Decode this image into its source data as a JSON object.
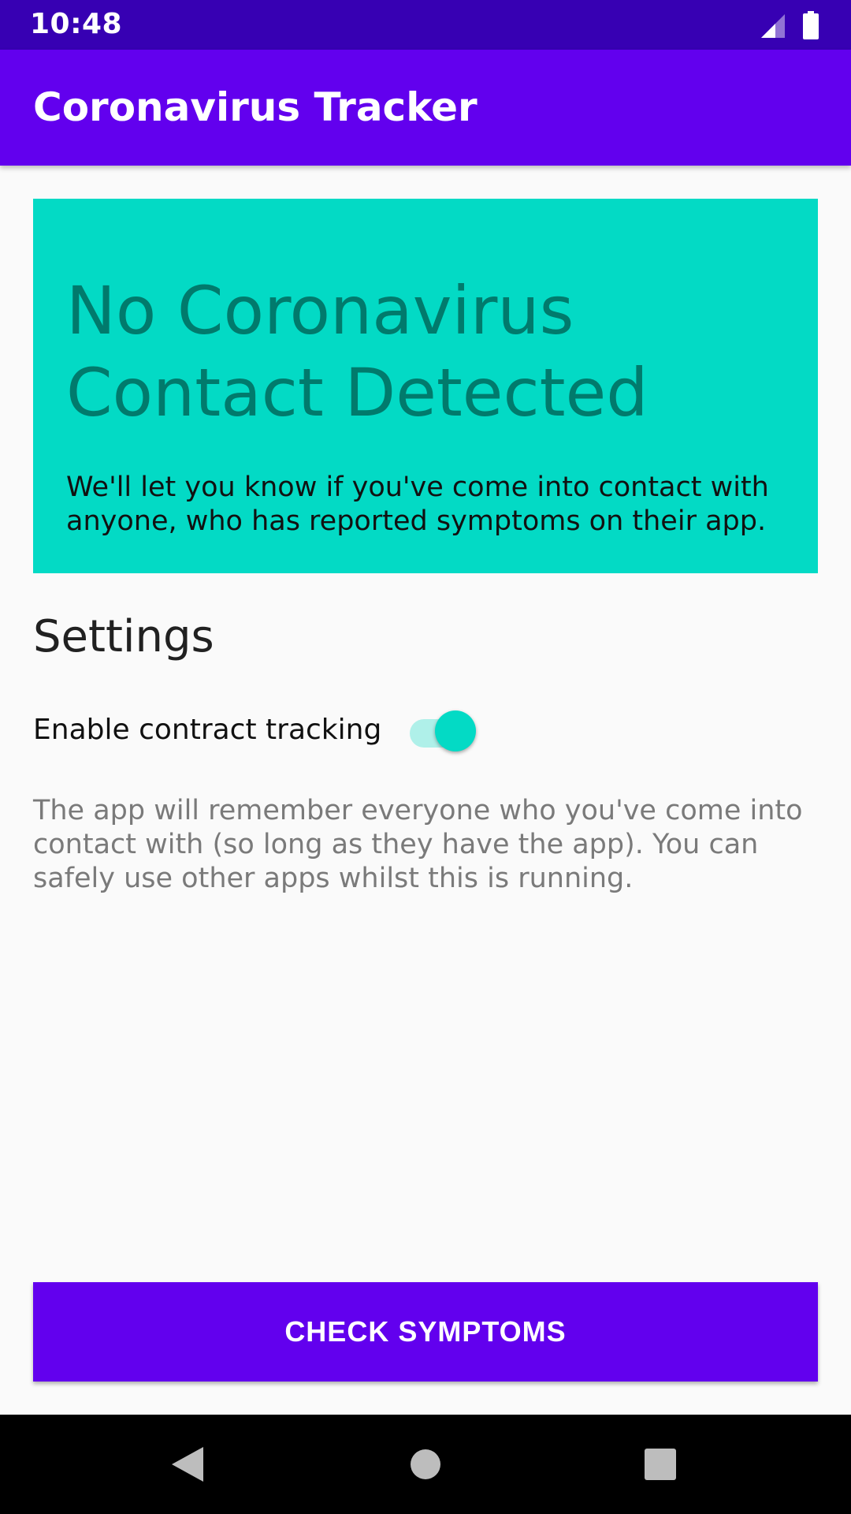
{
  "status_bar": {
    "time": "10:48",
    "icons": [
      "signal-icon",
      "battery-icon"
    ]
  },
  "app_bar": {
    "title": "Coronavirus Tracker"
  },
  "status_card": {
    "heading": "No Coronavirus Contact Detected",
    "body": "We'll let you know if you've come into contact with anyone, who has reported symptoms on their app.",
    "background_color": "#03dac5",
    "heading_color": "#017a6c"
  },
  "settings": {
    "heading": "Settings",
    "toggle_label": "Enable contract tracking",
    "toggle_on": true,
    "description": "The app will remember everyone who you've come into contact with (so long as they have the app). You can safely use other apps whilst this is running."
  },
  "actions": {
    "check_symptoms_label": "CHECK SYMPTOMS"
  },
  "nav_bar": {
    "icons": [
      "back-icon",
      "home-icon",
      "recents-icon"
    ]
  },
  "colors": {
    "primary": "#6200ee",
    "primary_dark": "#3700b3",
    "accent": "#03dac5"
  }
}
